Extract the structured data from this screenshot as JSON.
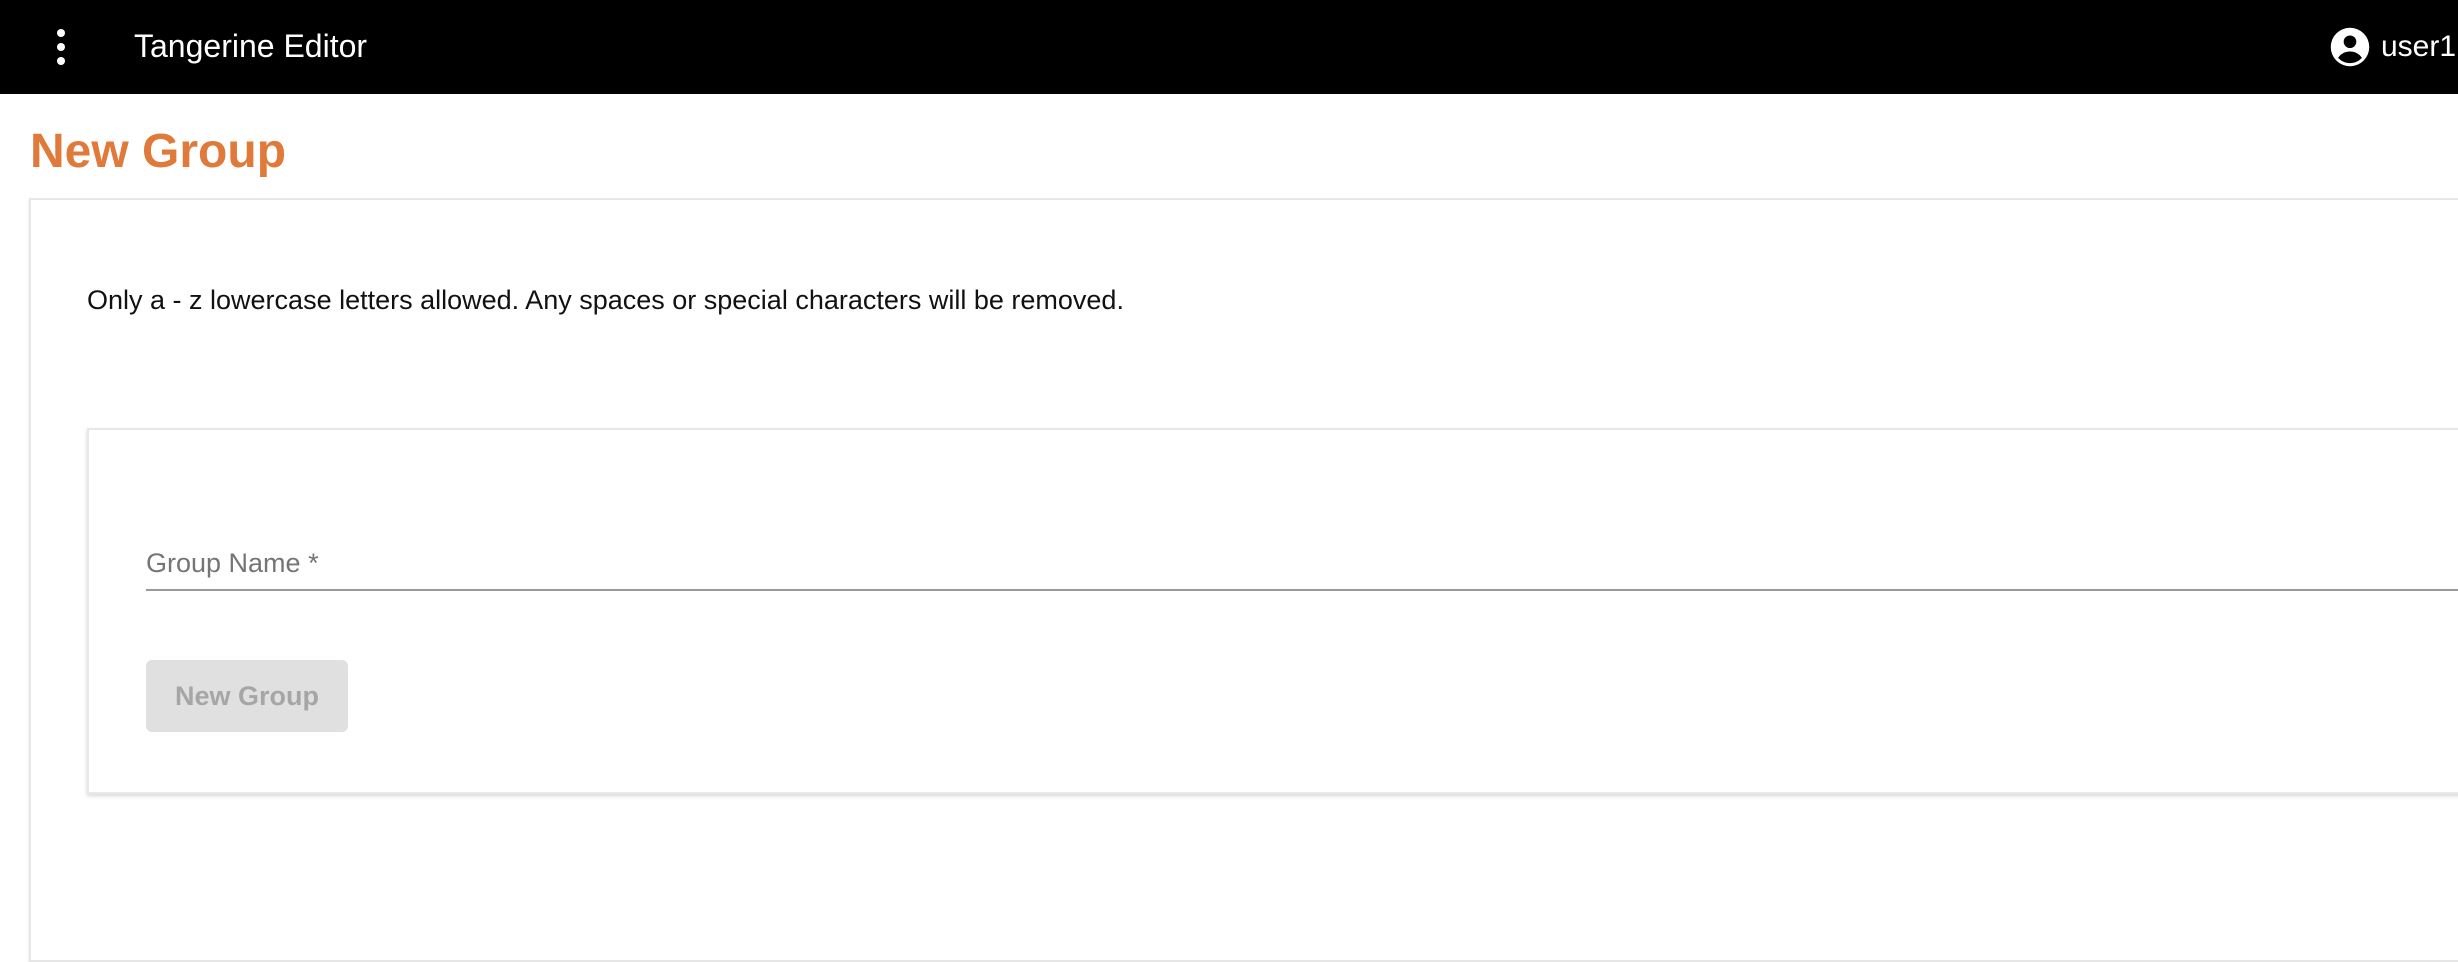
{
  "topbar": {
    "menu_icon": "more-vert-icon",
    "app_title": "Tangerine Editor",
    "user_icon": "account-circle-icon",
    "user_name": "user1"
  },
  "page": {
    "title": "New Group",
    "help_text": "Only a - z lowercase letters allowed. Any spaces or special characters will be removed."
  },
  "form": {
    "group_name_label": "Group Name *",
    "group_name_value": "",
    "submit_label": "New Group",
    "submit_disabled": true
  },
  "colors": {
    "topbar_bg": "#000000",
    "title_accent": "#e07a3a",
    "button_disabled_bg": "#e0e0e0",
    "button_disabled_text": "#a6a6a6"
  }
}
